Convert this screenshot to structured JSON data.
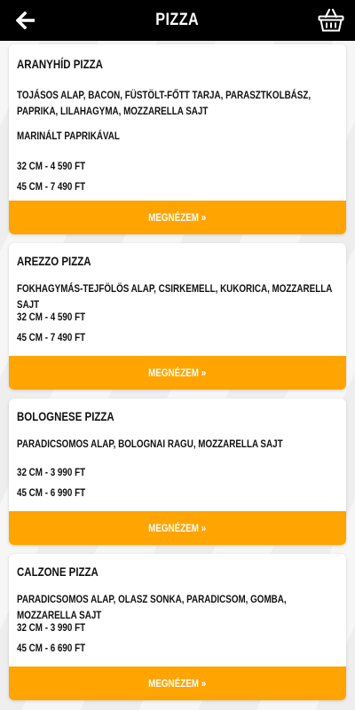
{
  "header": {
    "title": "PIZZA",
    "back_icon": "arrow-left-icon",
    "basket_icon": "basket-icon"
  },
  "colors": {
    "accent": "#FFA400",
    "header_bg": "#000000"
  },
  "products": [
    {
      "name": "ARANYHÍD PIZZA",
      "ingredients": "TOJÁSOS ALAP, BACON, FÜSTÖLT-FŐTT TARJA, PARASZTKOLBÁSZ, PAPRIKA, LILAHAGYMA, MOZZARELLA SAJT",
      "note": "MARINÁLT PAPRIKÁVAL",
      "price_32": "32 CM - 4 590 FT",
      "price_45": "45 CM - 7 490 FT",
      "button": "MEGNÉZEM »"
    },
    {
      "name": "AREZZO PIZZA",
      "ingredients": "FOKHAGYMÁS-TEJFÖLÖS ALAP, CSIRKEMELL, KUKORICA, MOZZARELLA SAJT",
      "price_32": "32 CM - 4 590 FT",
      "price_45": "45 CM - 7 490 FT",
      "button": "MEGNÉZEM »"
    },
    {
      "name": "BOLOGNESE PIZZA",
      "ingredients": "PARADICSOMOS ALAP, BOLOGNAI RAGU, MOZZARELLA SAJT",
      "price_32": "32 CM - 3 990 FT",
      "price_45": "45 CM - 6 990 FT",
      "button": "MEGNÉZEM »"
    },
    {
      "name": "CALZONE PIZZA",
      "ingredients": "PARADICSOMOS ALAP, OLASZ SONKA, PARADICSOM, GOMBA, MOZZARELLA SAJT",
      "price_32": "32 CM - 3 990 FT",
      "price_45": "45 CM - 6 690 FT",
      "button": "MEGNÉZEM »"
    }
  ]
}
